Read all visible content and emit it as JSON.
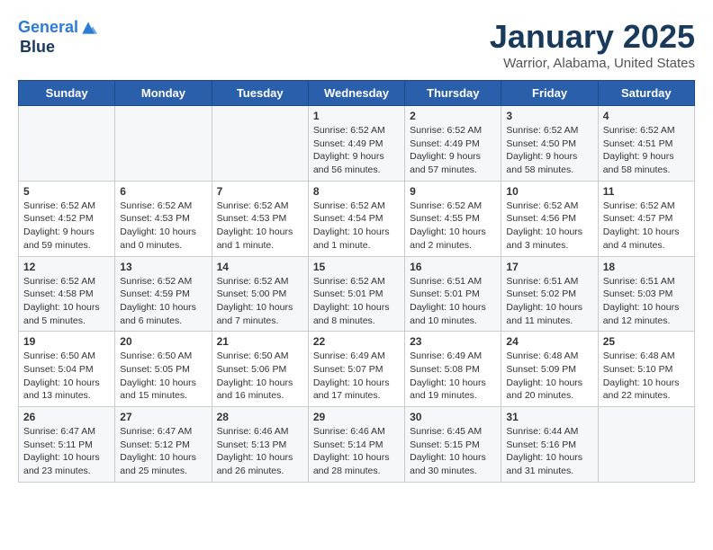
{
  "header": {
    "logo_line1": "General",
    "logo_line2": "Blue",
    "month_title": "January 2025",
    "location": "Warrior, Alabama, United States"
  },
  "weekdays": [
    "Sunday",
    "Monday",
    "Tuesday",
    "Wednesday",
    "Thursday",
    "Friday",
    "Saturday"
  ],
  "weeks": [
    [
      {
        "day": "",
        "info": ""
      },
      {
        "day": "",
        "info": ""
      },
      {
        "day": "",
        "info": ""
      },
      {
        "day": "1",
        "info": "Sunrise: 6:52 AM\nSunset: 4:49 PM\nDaylight: 9 hours\nand 56 minutes."
      },
      {
        "day": "2",
        "info": "Sunrise: 6:52 AM\nSunset: 4:49 PM\nDaylight: 9 hours\nand 57 minutes."
      },
      {
        "day": "3",
        "info": "Sunrise: 6:52 AM\nSunset: 4:50 PM\nDaylight: 9 hours\nand 58 minutes."
      },
      {
        "day": "4",
        "info": "Sunrise: 6:52 AM\nSunset: 4:51 PM\nDaylight: 9 hours\nand 58 minutes."
      }
    ],
    [
      {
        "day": "5",
        "info": "Sunrise: 6:52 AM\nSunset: 4:52 PM\nDaylight: 9 hours\nand 59 minutes."
      },
      {
        "day": "6",
        "info": "Sunrise: 6:52 AM\nSunset: 4:53 PM\nDaylight: 10 hours\nand 0 minutes."
      },
      {
        "day": "7",
        "info": "Sunrise: 6:52 AM\nSunset: 4:53 PM\nDaylight: 10 hours\nand 1 minute."
      },
      {
        "day": "8",
        "info": "Sunrise: 6:52 AM\nSunset: 4:54 PM\nDaylight: 10 hours\nand 1 minute."
      },
      {
        "day": "9",
        "info": "Sunrise: 6:52 AM\nSunset: 4:55 PM\nDaylight: 10 hours\nand 2 minutes."
      },
      {
        "day": "10",
        "info": "Sunrise: 6:52 AM\nSunset: 4:56 PM\nDaylight: 10 hours\nand 3 minutes."
      },
      {
        "day": "11",
        "info": "Sunrise: 6:52 AM\nSunset: 4:57 PM\nDaylight: 10 hours\nand 4 minutes."
      }
    ],
    [
      {
        "day": "12",
        "info": "Sunrise: 6:52 AM\nSunset: 4:58 PM\nDaylight: 10 hours\nand 5 minutes."
      },
      {
        "day": "13",
        "info": "Sunrise: 6:52 AM\nSunset: 4:59 PM\nDaylight: 10 hours\nand 6 minutes."
      },
      {
        "day": "14",
        "info": "Sunrise: 6:52 AM\nSunset: 5:00 PM\nDaylight: 10 hours\nand 7 minutes."
      },
      {
        "day": "15",
        "info": "Sunrise: 6:52 AM\nSunset: 5:01 PM\nDaylight: 10 hours\nand 8 minutes."
      },
      {
        "day": "16",
        "info": "Sunrise: 6:51 AM\nSunset: 5:01 PM\nDaylight: 10 hours\nand 10 minutes."
      },
      {
        "day": "17",
        "info": "Sunrise: 6:51 AM\nSunset: 5:02 PM\nDaylight: 10 hours\nand 11 minutes."
      },
      {
        "day": "18",
        "info": "Sunrise: 6:51 AM\nSunset: 5:03 PM\nDaylight: 10 hours\nand 12 minutes."
      }
    ],
    [
      {
        "day": "19",
        "info": "Sunrise: 6:50 AM\nSunset: 5:04 PM\nDaylight: 10 hours\nand 13 minutes."
      },
      {
        "day": "20",
        "info": "Sunrise: 6:50 AM\nSunset: 5:05 PM\nDaylight: 10 hours\nand 15 minutes."
      },
      {
        "day": "21",
        "info": "Sunrise: 6:50 AM\nSunset: 5:06 PM\nDaylight: 10 hours\nand 16 minutes."
      },
      {
        "day": "22",
        "info": "Sunrise: 6:49 AM\nSunset: 5:07 PM\nDaylight: 10 hours\nand 17 minutes."
      },
      {
        "day": "23",
        "info": "Sunrise: 6:49 AM\nSunset: 5:08 PM\nDaylight: 10 hours\nand 19 minutes."
      },
      {
        "day": "24",
        "info": "Sunrise: 6:48 AM\nSunset: 5:09 PM\nDaylight: 10 hours\nand 20 minutes."
      },
      {
        "day": "25",
        "info": "Sunrise: 6:48 AM\nSunset: 5:10 PM\nDaylight: 10 hours\nand 22 minutes."
      }
    ],
    [
      {
        "day": "26",
        "info": "Sunrise: 6:47 AM\nSunset: 5:11 PM\nDaylight: 10 hours\nand 23 minutes."
      },
      {
        "day": "27",
        "info": "Sunrise: 6:47 AM\nSunset: 5:12 PM\nDaylight: 10 hours\nand 25 minutes."
      },
      {
        "day": "28",
        "info": "Sunrise: 6:46 AM\nSunset: 5:13 PM\nDaylight: 10 hours\nand 26 minutes."
      },
      {
        "day": "29",
        "info": "Sunrise: 6:46 AM\nSunset: 5:14 PM\nDaylight: 10 hours\nand 28 minutes."
      },
      {
        "day": "30",
        "info": "Sunrise: 6:45 AM\nSunset: 5:15 PM\nDaylight: 10 hours\nand 30 minutes."
      },
      {
        "day": "31",
        "info": "Sunrise: 6:44 AM\nSunset: 5:16 PM\nDaylight: 10 hours\nand 31 minutes."
      },
      {
        "day": "",
        "info": ""
      }
    ]
  ]
}
